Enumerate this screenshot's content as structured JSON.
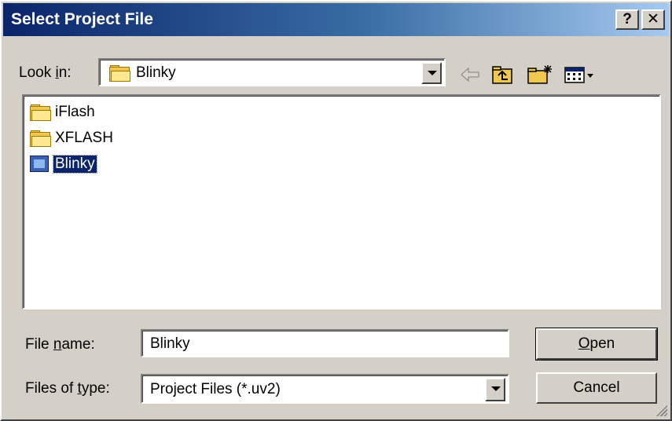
{
  "window": {
    "title": "Select Project File",
    "help_button": "?",
    "close_button": "✕"
  },
  "look_in": {
    "label_prefix": "Look ",
    "label_accel": "i",
    "label_suffix": "n:",
    "value": "Blinky"
  },
  "toolbar": {
    "back_icon": "back-arrow-icon",
    "up_icon": "up-one-level-icon",
    "new_folder_icon": "new-folder-icon",
    "view_menu_icon": "view-menu-icon"
  },
  "file_list": {
    "items": [
      {
        "name": "iFlash",
        "icon": "folder-icon",
        "selected": false
      },
      {
        "name": "XFLASH",
        "icon": "folder-icon",
        "selected": false
      },
      {
        "name": "Blinky",
        "icon": "project-file-icon",
        "selected": true
      }
    ]
  },
  "file_name": {
    "label_prefix": "File ",
    "label_accel": "n",
    "label_suffix": "ame:",
    "value": "Blinky"
  },
  "file_type": {
    "label_prefix": "Files of ",
    "label_accel": "t",
    "label_suffix": "ype:",
    "value": "Project Files (*.uv2)"
  },
  "buttons": {
    "open_accel": "O",
    "open_rest": "pen",
    "cancel": "Cancel"
  },
  "colors": {
    "title_gradient_start": "#0a246a",
    "title_gradient_end": "#a6caf0",
    "window_face": "#d4d0c8",
    "selection": "#0a246a"
  }
}
